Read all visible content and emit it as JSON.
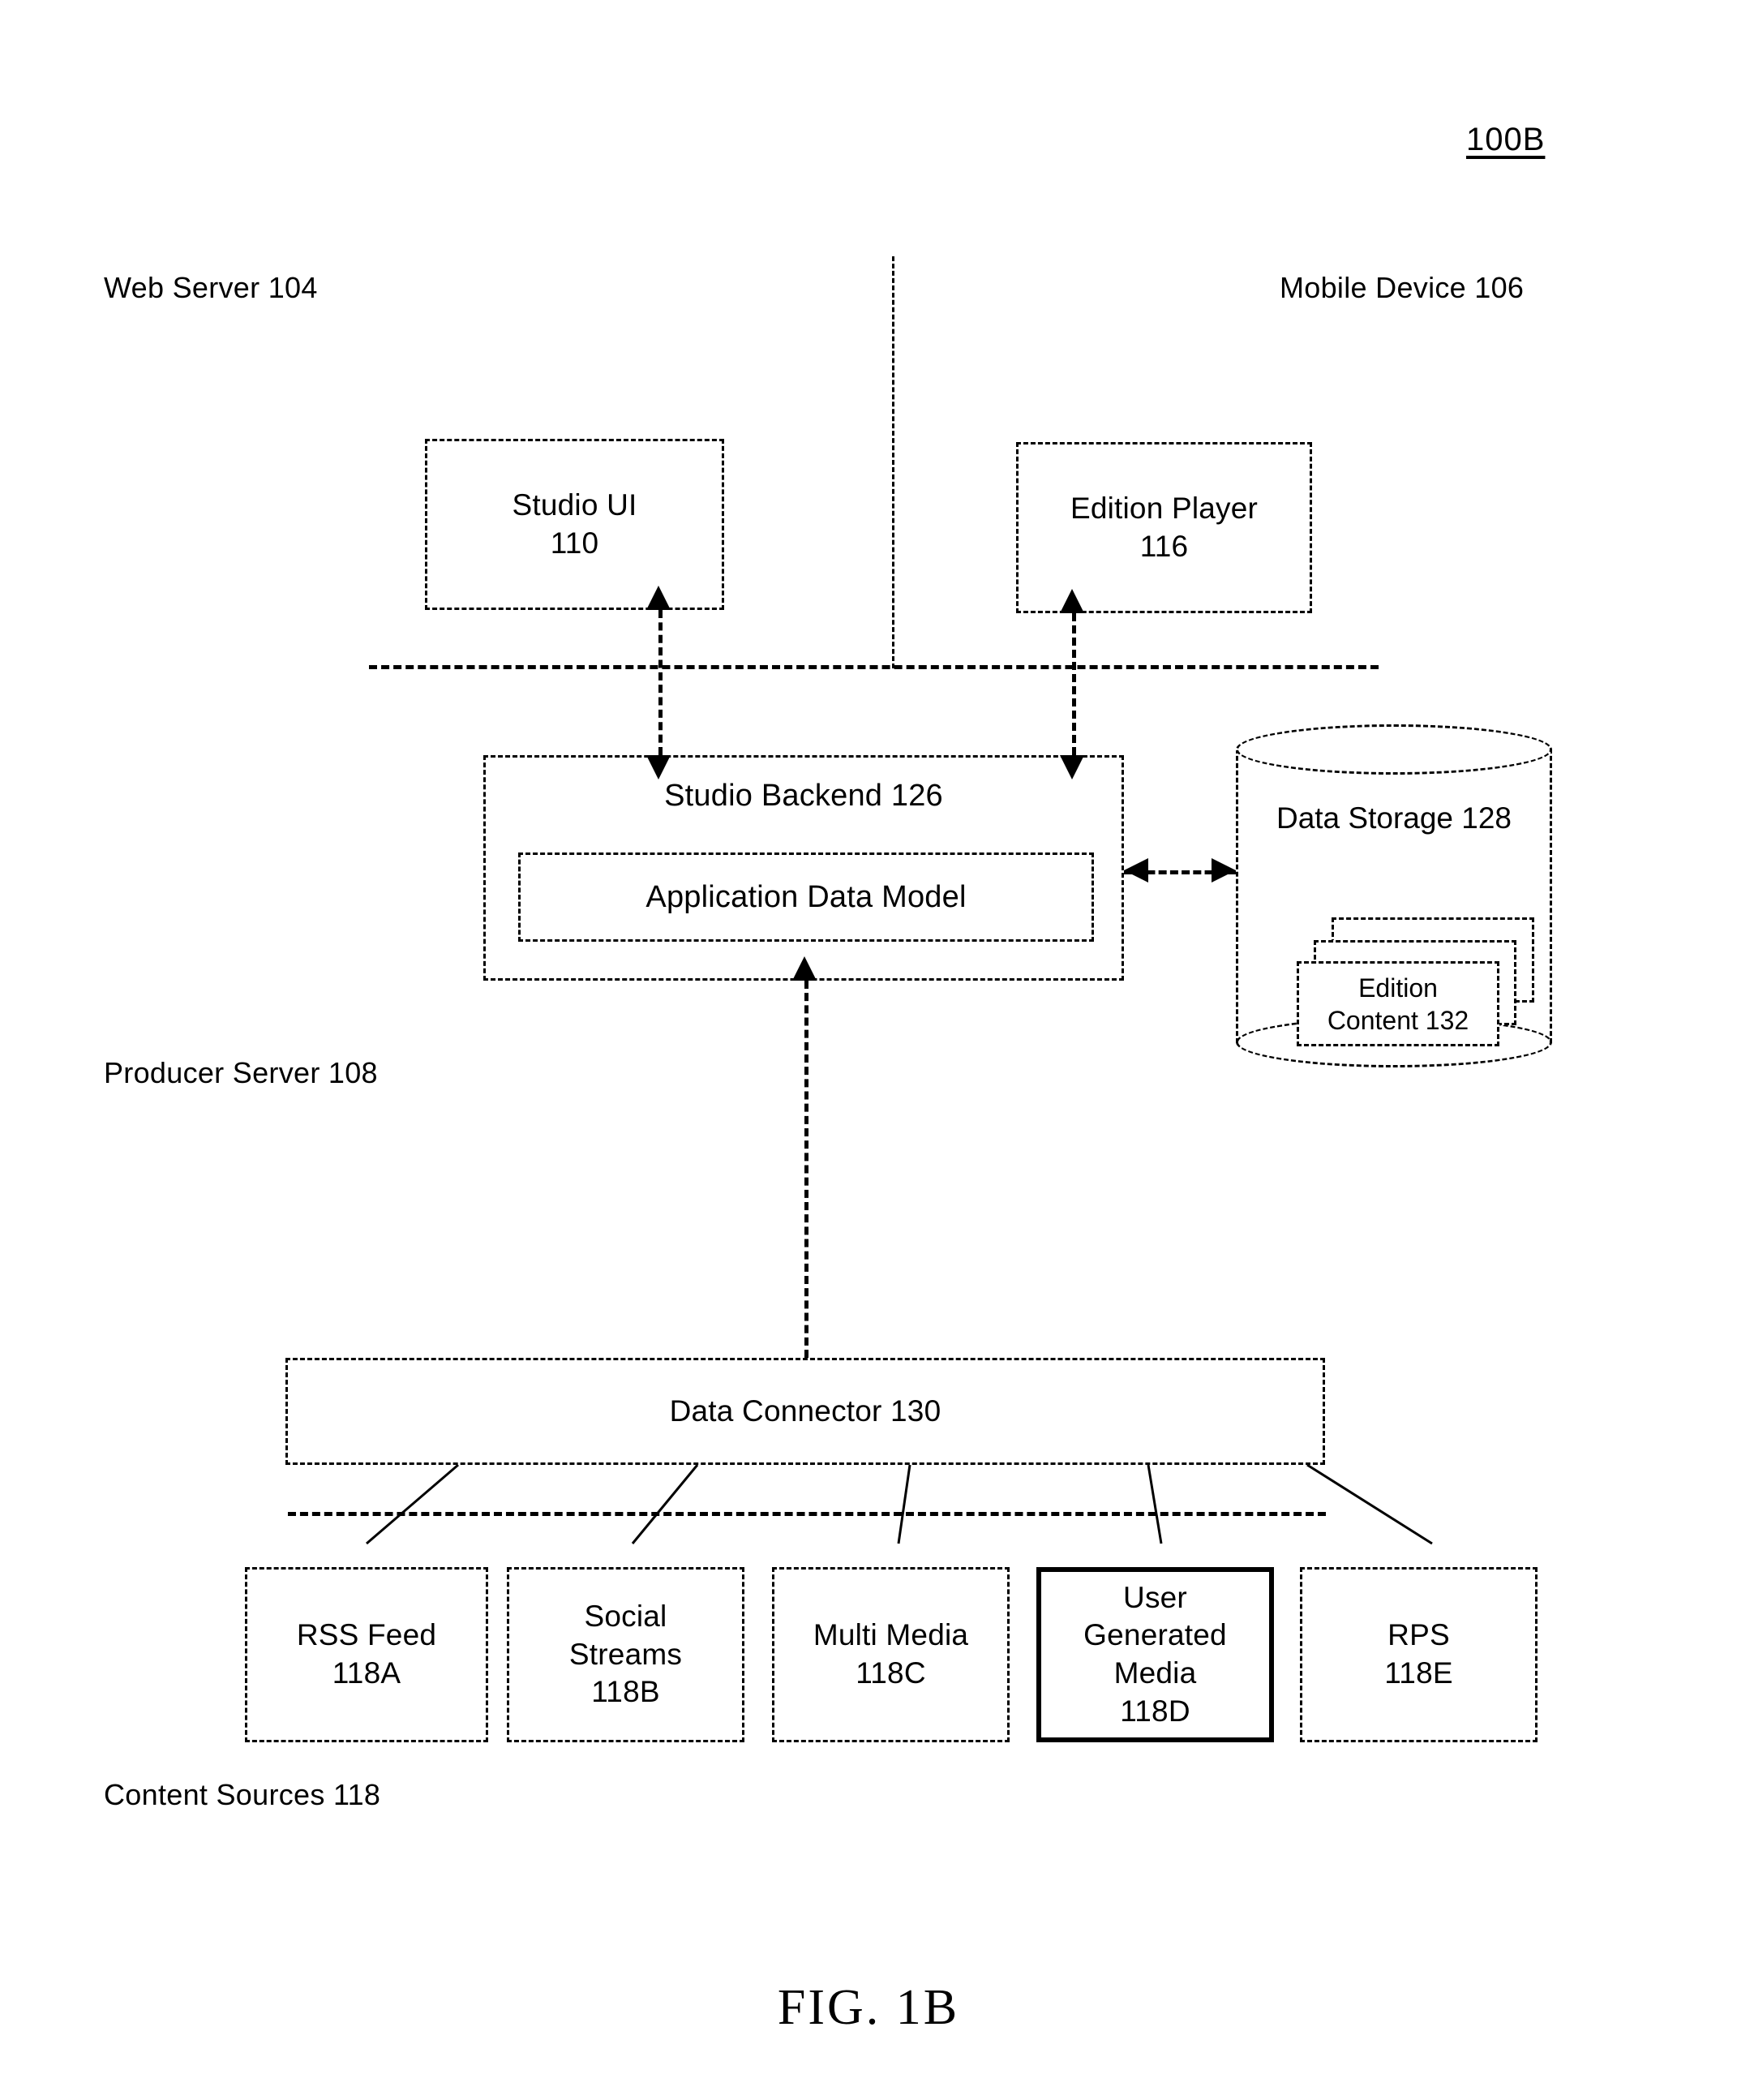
{
  "figure": {
    "number_label": "100B",
    "caption": "FIG. 1B"
  },
  "regions": {
    "web_server": "Web Server 104",
    "mobile_device": "Mobile Device 106",
    "producer_server": "Producer Server 108",
    "content_sources": "Content Sources 118"
  },
  "nodes": {
    "studio_ui": {
      "line1": "Studio UI",
      "line2": "110"
    },
    "edition_player": {
      "line1": "Edition Player",
      "line2": "116"
    },
    "studio_backend": {
      "title": "Studio Backend 126"
    },
    "application_data_model": {
      "label": "Application Data Model"
    },
    "data_storage": {
      "line1": "Data Storage",
      "line2": "128"
    },
    "edition_content": {
      "line1": "Edition",
      "line2": "Content 132"
    },
    "data_connector": {
      "label": "Data Connector 130"
    }
  },
  "content_sources": [
    {
      "name": "rss-feed",
      "lines": [
        "RSS Feed",
        "118A"
      ],
      "emphasized": false
    },
    {
      "name": "social-streams",
      "lines": [
        "Social",
        "Streams",
        "118B"
      ],
      "emphasized": false
    },
    {
      "name": "multi-media",
      "lines": [
        "Multi Media",
        "118C"
      ],
      "emphasized": false
    },
    {
      "name": "user-generated-media",
      "lines": [
        "User",
        "Generated",
        "Media",
        "118D"
      ],
      "emphasized": true
    },
    {
      "name": "rps",
      "lines": [
        "RPS",
        "118E"
      ],
      "emphasized": false
    }
  ],
  "colors": {
    "ink": "#000000",
    "background": "#ffffff"
  }
}
